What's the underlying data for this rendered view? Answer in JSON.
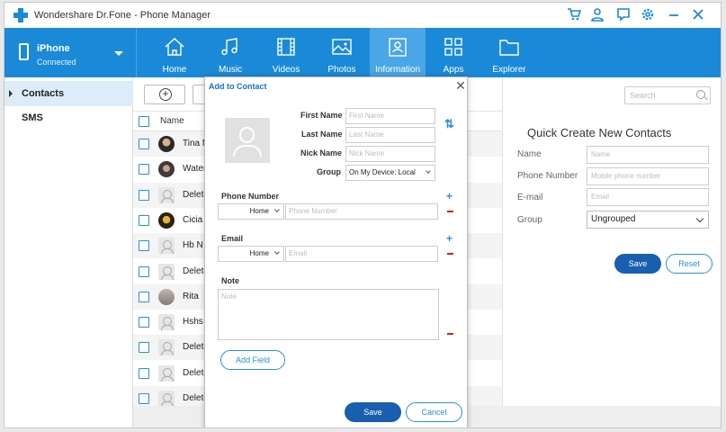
{
  "app": {
    "title": "Wondershare Dr.Fone - Phone Manager"
  },
  "colors": {
    "accent": "#1a8ad8",
    "button_dark": "#185fb0",
    "delete_red": "#d81e1e"
  },
  "titlebar_icons": [
    "cart-icon",
    "user-icon",
    "feedback-icon",
    "settings-icon",
    "minimize-icon",
    "close-icon"
  ],
  "device": {
    "name": "iPhone",
    "status": "Connected"
  },
  "nav": [
    {
      "label": "Home",
      "icon": "home-icon"
    },
    {
      "label": "Music",
      "icon": "music-icon"
    },
    {
      "label": "Videos",
      "icon": "video-icon"
    },
    {
      "label": "Photos",
      "icon": "photo-icon"
    },
    {
      "label": "Information",
      "icon": "contact-card-icon",
      "active": true
    },
    {
      "label": "Apps",
      "icon": "apps-icon"
    },
    {
      "label": "Explorer",
      "icon": "folder-icon"
    }
  ],
  "sidebar": {
    "items": [
      {
        "label": "Contacts",
        "active": true
      },
      {
        "label": "SMS"
      }
    ]
  },
  "list": {
    "header_name": "Name",
    "rows": [
      {
        "name": "Tina Mi",
        "avatar": "photo1"
      },
      {
        "name": "Water P",
        "avatar": "photo2"
      },
      {
        "name": "Deleted",
        "avatar": "generic"
      },
      {
        "name": "Cicia H",
        "avatar": "photo3"
      },
      {
        "name": "Hb N",
        "avatar": "generic"
      },
      {
        "name": "Deleted",
        "avatar": "generic"
      },
      {
        "name": "Rita",
        "avatar": "photo4"
      },
      {
        "name": "Hshs U",
        "avatar": "generic"
      },
      {
        "name": "Deleted",
        "avatar": "generic"
      },
      {
        "name": "Deleted",
        "avatar": "generic"
      },
      {
        "name": "Deleted",
        "avatar": "generic"
      }
    ]
  },
  "search": {
    "placeholder": "Search"
  },
  "quick_create": {
    "title": "Quick Create New Contacts",
    "fields": [
      {
        "label": "Name",
        "placeholder": "Name"
      },
      {
        "label": "Phone Number",
        "placeholder": "Mobile phone number"
      },
      {
        "label": "E-mail",
        "placeholder": "Email"
      }
    ],
    "group_label": "Group",
    "group_value": "Ungrouped",
    "save_label": "Save",
    "reset_label": "Reset"
  },
  "modal": {
    "title": "Add to Contact",
    "first_name_label": "First Name",
    "first_name_placeholder": "First Name",
    "last_name_label": "Last Name",
    "last_name_placeholder": "Last Name",
    "nick_name_label": "Nick Name",
    "nick_name_placeholder": "Nick Name",
    "group_label": "Group",
    "group_value": "On My Device: Local",
    "phone_section": "Phone Number",
    "phone_type": "Home",
    "phone_placeholder": "Phone Number",
    "email_section": "Email",
    "email_type": "Home",
    "email_placeholder": "Email",
    "note_section": "Note",
    "note_placeholder": "Note",
    "add_field_label": "Add Field",
    "save_label": "Save",
    "cancel_label": "Cancel"
  }
}
